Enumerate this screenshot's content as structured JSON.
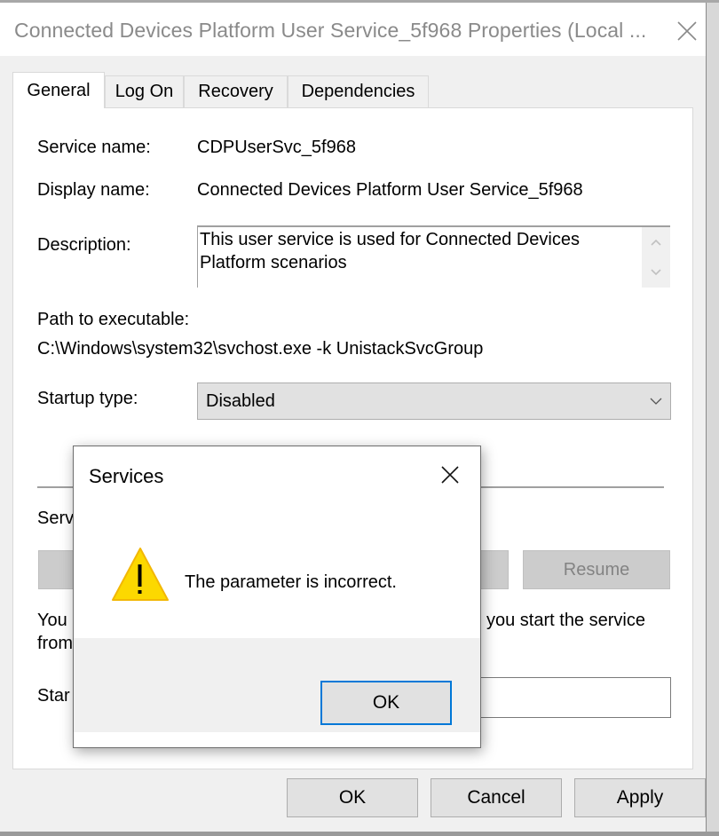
{
  "window": {
    "title": "Connected Devices Platform User Service_5f968 Properties (Local ...",
    "close_icon": "close-icon"
  },
  "tabs": [
    {
      "label": "General",
      "active": true
    },
    {
      "label": "Log On",
      "active": false
    },
    {
      "label": "Recovery",
      "active": false
    },
    {
      "label": "Dependencies",
      "active": false
    }
  ],
  "general": {
    "service_name_label": "Service name:",
    "service_name_value": "CDPUserSvc_5f968",
    "display_name_label": "Display name:",
    "display_name_value": "Connected Devices Platform User Service_5f968",
    "description_label": "Description:",
    "description_value": "This user service is used for Connected Devices Platform scenarios",
    "path_label": "Path to executable:",
    "path_value": "C:\\Windows\\system32\\svchost.exe -k UnistackSvcGroup",
    "startup_type_label": "Startup type:",
    "startup_type_value": "Disabled",
    "service_status_label_partial": "Serv",
    "resume_button": "Resume",
    "help_text_partial_1": "You",
    "help_text_partial_2": "from",
    "help_text_right": "you start the service",
    "start_params_label_partial": "Star"
  },
  "footer": {
    "ok": "OK",
    "cancel": "Cancel",
    "apply": "Apply"
  },
  "message_box": {
    "title": "Services",
    "message": "The parameter is incorrect.",
    "icon": "warning-icon",
    "ok": "OK",
    "accent_color": "#0078d7"
  }
}
